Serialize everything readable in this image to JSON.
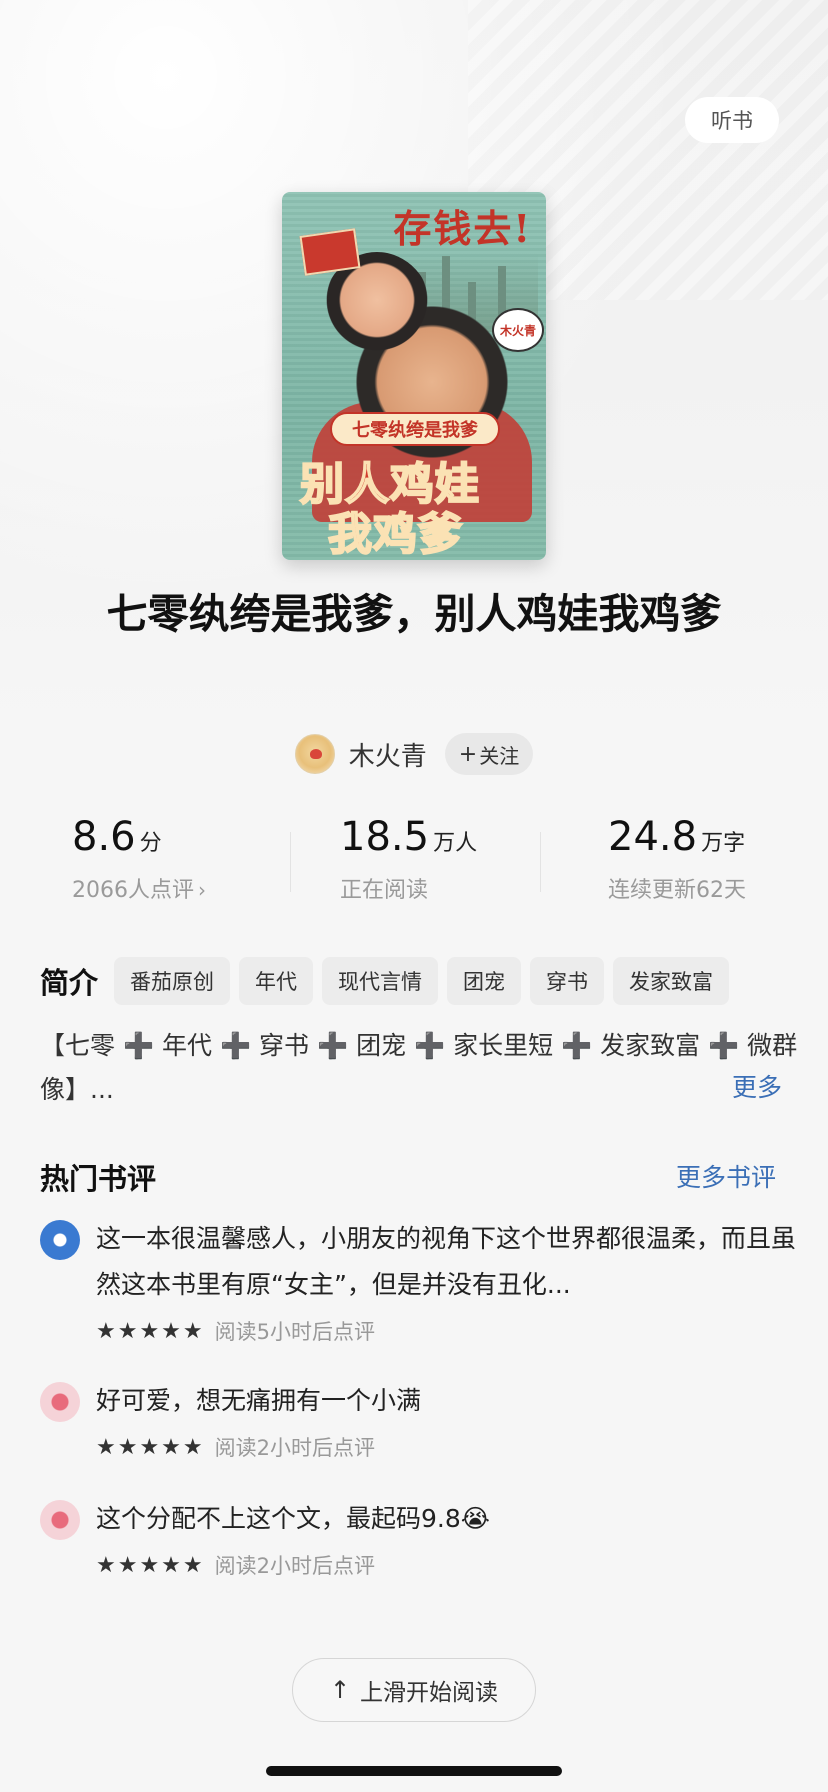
{
  "header": {
    "listen_label": "听书"
  },
  "cover": {
    "top_text": "存钱去!",
    "bubble_text": "木火青",
    "subtitle": "七零纨绔是我爹",
    "main_line1": "别人鸡娃",
    "main_line2": "我鸡爹"
  },
  "book": {
    "title": "七零纨绔是我爹，别人鸡娃我鸡爹"
  },
  "author": {
    "name": "木火青",
    "follow_label": "关注",
    "follow_plus": "+"
  },
  "stats": [
    {
      "value": "8.6",
      "unit": "分",
      "sub": "2066人点评",
      "chevron": "›"
    },
    {
      "value": "18.5",
      "unit": "万人",
      "sub": "正在阅读"
    },
    {
      "value": "24.8",
      "unit": "万字",
      "sub": "连续更新62天"
    }
  ],
  "intro": {
    "label": "简介",
    "tags": [
      "番茄原创",
      "年代",
      "现代言情",
      "团宠",
      "穿书",
      "发家致富"
    ],
    "text": "【七零 ➕ 年代 ➕ 穿书 ➕ 团宠 ➕ 家长里短 ➕ 发家致富 ➕ 微群像】...",
    "more_label": "更多"
  },
  "hot_reviews": {
    "title": "热门书评",
    "more_label": "更多书评",
    "items": [
      {
        "text": "这一本很温馨感人，小朋友的视角下这个世界都很温柔，而且虽然这本书里有原“女主”，但是并没有丑化...",
        "stars": "★★★★★",
        "meta": "阅读5小时后点评"
      },
      {
        "text": "好可爱，想无痛拥有一个小满",
        "stars": "★★★★★",
        "meta": "阅读2小时后点评"
      },
      {
        "text": "这个分配不上这个文，最起码9.8😭",
        "stars": "★★★★★",
        "meta": "阅读2小时后点评"
      }
    ]
  },
  "footer": {
    "start_label": "上滑开始阅读",
    "arrow": "↑"
  }
}
